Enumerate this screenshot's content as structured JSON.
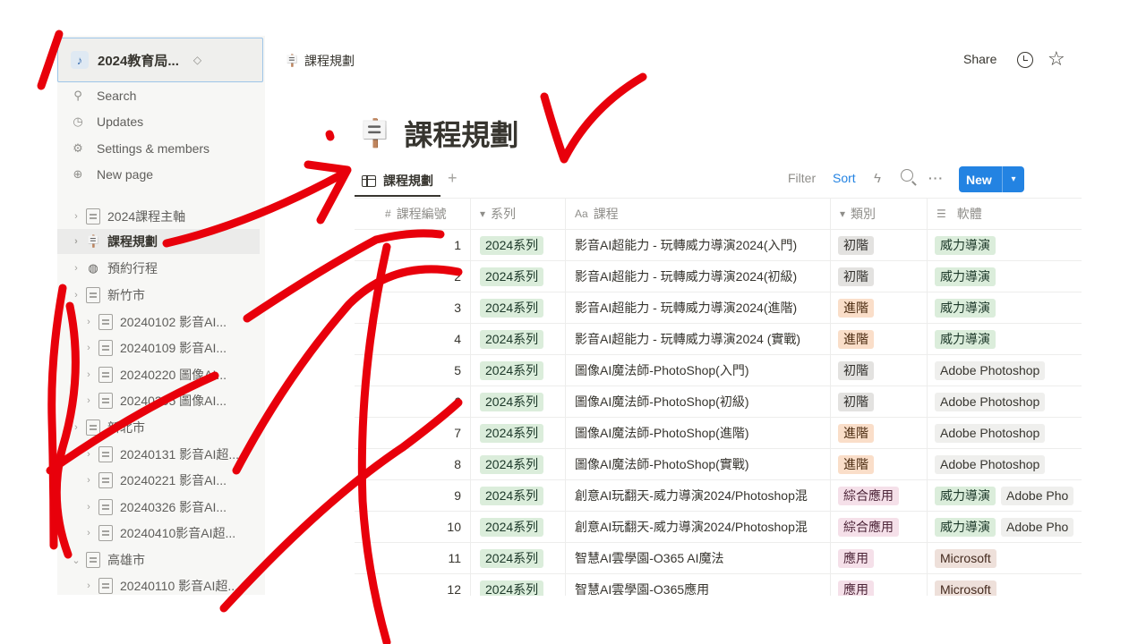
{
  "colors": {
    "accent": "#2383e2",
    "ink": "#e8000b"
  },
  "sidebar": {
    "workspace_name": "2024教育局...",
    "menu": [
      {
        "label": "Search",
        "icon": "search-icon"
      },
      {
        "label": "Updates",
        "icon": "clock-icon"
      },
      {
        "label": "Settings & members",
        "icon": "gear-icon"
      },
      {
        "label": "New page",
        "icon": "plus-circle-icon"
      }
    ],
    "tree": [
      {
        "label": "2024課程主軸",
        "icon": "page-icon",
        "indent": 0
      },
      {
        "label": "課程規劃",
        "icon": "sign-icon",
        "indent": 0,
        "active": true
      },
      {
        "label": "預約行程",
        "icon": "globe-icon",
        "indent": 0
      },
      {
        "label": "新竹市",
        "icon": "page-icon",
        "indent": 0
      },
      {
        "label": "20240102 影音AI...",
        "icon": "page-icon",
        "indent": 1
      },
      {
        "label": "20240109 影音AI...",
        "icon": "page-icon",
        "indent": 1
      },
      {
        "label": "20240220 圖像AI...",
        "icon": "page-icon",
        "indent": 1
      },
      {
        "label": "20240305 圖像AI...",
        "icon": "page-icon",
        "indent": 1
      },
      {
        "label": "新北市",
        "icon": "page-icon",
        "indent": 0
      },
      {
        "label": "20240131 影音AI超...",
        "icon": "page-icon",
        "indent": 1
      },
      {
        "label": "20240221 影音AI...",
        "icon": "page-icon",
        "indent": 1
      },
      {
        "label": "20240326 影音AI...",
        "icon": "page-icon",
        "indent": 1
      },
      {
        "label": "20240410影音AI超...",
        "icon": "page-icon",
        "indent": 1
      },
      {
        "label": "高雄市",
        "icon": "page-icon",
        "indent": 0,
        "expanded": true
      },
      {
        "label": "20240110 影音AI超...",
        "icon": "page-icon",
        "indent": 1
      }
    ]
  },
  "topbar": {
    "breadcrumb": "課程規劃",
    "share_label": "Share"
  },
  "page": {
    "title": "課程規劃",
    "view_tab": "課程規劃"
  },
  "toolbar": {
    "filter": "Filter",
    "sort": "Sort",
    "new_label": "New"
  },
  "table": {
    "headers": [
      "課程編號",
      "系列",
      "課程",
      "類別",
      "軟體"
    ],
    "header_icons": [
      "#",
      "▾",
      "Aa",
      "▾",
      "☰"
    ],
    "rows": [
      {
        "num": "1",
        "series": "2024系列",
        "course": "影音AI超能力 - 玩轉威力導演2024(入門)",
        "category": "初階",
        "cat_color": "gray",
        "software": [
          "威力導演"
        ]
      },
      {
        "num": "2",
        "series": "2024系列",
        "course": "影音AI超能力 - 玩轉威力導演2024(初級)",
        "category": "初階",
        "cat_color": "gray",
        "software": [
          "威力導演"
        ]
      },
      {
        "num": "3",
        "series": "2024系列",
        "course": "影音AI超能力 - 玩轉威力導演2024(進階)",
        "category": "進階",
        "cat_color": "orange",
        "software": [
          "威力導演"
        ]
      },
      {
        "num": "4",
        "series": "2024系列",
        "course": "影音AI超能力 - 玩轉威力導演2024 (實戰)",
        "category": "進階",
        "cat_color": "orange",
        "software": [
          "威力導演"
        ]
      },
      {
        "num": "5",
        "series": "2024系列",
        "course": "圖像AI魔法師-PhotoShop(入門)",
        "category": "初階",
        "cat_color": "gray",
        "software": [
          "Adobe Photoshop"
        ]
      },
      {
        "num": "6",
        "series": "2024系列",
        "course": "圖像AI魔法師-PhotoShop(初級)",
        "category": "初階",
        "cat_color": "gray",
        "software": [
          "Adobe Photoshop"
        ]
      },
      {
        "num": "7",
        "series": "2024系列",
        "course": "圖像AI魔法師-PhotoShop(進階)",
        "category": "進階",
        "cat_color": "orange",
        "software": [
          "Adobe Photoshop"
        ]
      },
      {
        "num": "8",
        "series": "2024系列",
        "course": "圖像AI魔法師-PhotoShop(實戰)",
        "category": "進階",
        "cat_color": "orange",
        "software": [
          "Adobe Photoshop"
        ]
      },
      {
        "num": "9",
        "series": "2024系列",
        "course": "創意AI玩翻天-威力導演2024/Photoshop混",
        "category": "綜合應用",
        "cat_color": "pink",
        "software": [
          "威力導演",
          "Adobe Pho"
        ]
      },
      {
        "num": "10",
        "series": "2024系列",
        "course": "創意AI玩翻天-威力導演2024/Photoshop混",
        "category": "綜合應用",
        "cat_color": "pink",
        "software": [
          "威力導演",
          "Adobe Pho"
        ]
      },
      {
        "num": "11",
        "series": "2024系列",
        "course": "智慧AI雲學園-O365 AI魔法",
        "category": "應用",
        "cat_color": "pink",
        "software": [
          "Microsoft"
        ]
      },
      {
        "num": "12",
        "series": "2024系列",
        "course": "智慧AI雲學園-O365應用",
        "category": "應用",
        "cat_color": "pink",
        "software": [
          "Microsoft"
        ]
      }
    ]
  }
}
